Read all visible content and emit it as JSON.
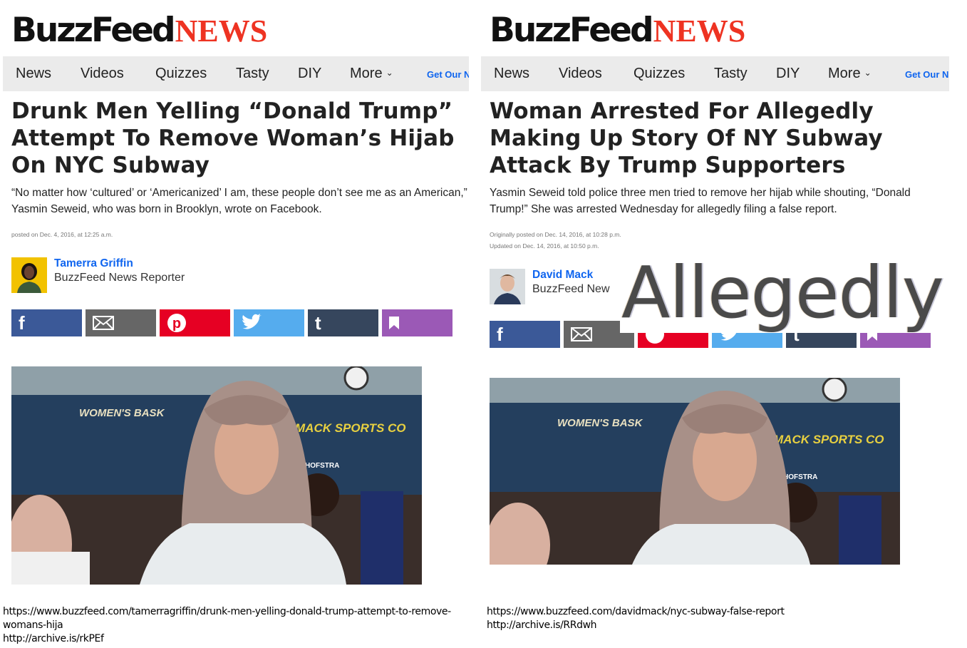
{
  "brand": {
    "buzzfeed": "BuzzFeed",
    "news": "NEWS"
  },
  "nav": {
    "items": [
      "News",
      "Videos",
      "Quizzes",
      "Tasty",
      "DIY",
      "More"
    ],
    "cta": "Get Our N"
  },
  "colors": {
    "accent_blue": "#0f65ef",
    "news_red": "#ee3322",
    "facebook": "#3b5998",
    "email": "#666666",
    "pinterest": "#e60023",
    "twitter": "#55acee",
    "tumblr": "#36465d",
    "bookmark": "#9b59b6"
  },
  "share_icons": [
    "facebook-icon",
    "email-icon",
    "pinterest-icon",
    "twitter-icon",
    "tumblr-icon",
    "bookmark-icon"
  ],
  "left": {
    "headline": "Drunk Men Yelling “Donald Trump” Attempt To Remove Woman’s Hijab On NYC Subway",
    "dek": "“No matter how ‘cultured’ or ‘Americanized’ I am, these people don’t see me as an American,” Yasmin Seweid, who was born in Brooklyn, wrote on Facebook.",
    "posted": "posted on Dec. 4, 2016, at 12:25 a.m.",
    "author": {
      "name": "Tamerra Griffin",
      "role": "BuzzFeed News Reporter"
    },
    "photo_text": {
      "banner_left": "WOMEN'S BASK",
      "banner_right": "MACK SPORTS CO",
      "logo": "HOFSTRA"
    },
    "source_lines": [
      "https://www.buzzfeed.com/tamerragriffin/drunk-men-yelling-donald-trump-attempt-to-remove-",
      "womans-hija",
      "http://archive.is/rkPEf"
    ]
  },
  "right": {
    "headline": "Woman Arrested For Allegedly Making Up Story Of NY Subway Attack By Trump Supporters",
    "dek": "Yasmin Seweid told police three men tried to remove her hijab while shouting, “Donald Trump!” She was arrested Wednesday for allegedly filing a false report.",
    "posted_lines": [
      "Originally posted on Dec. 14, 2016, at 10:28 p.m.",
      "Updated on Dec. 14, 2016, at 10:50 p.m."
    ],
    "author": {
      "name": "David Mack",
      "role": "BuzzFeed New"
    },
    "photo_text": {
      "banner_left": "WOMEN'S BASK",
      "banner_right": "MACK SPORTS CO",
      "logo": "HOFSTRA"
    },
    "source_lines": [
      "https://www.buzzfeed.com/davidmack/nyc-subway-false-report",
      "http://archive.is/RRdwh"
    ]
  },
  "stamp": "Allegedly"
}
